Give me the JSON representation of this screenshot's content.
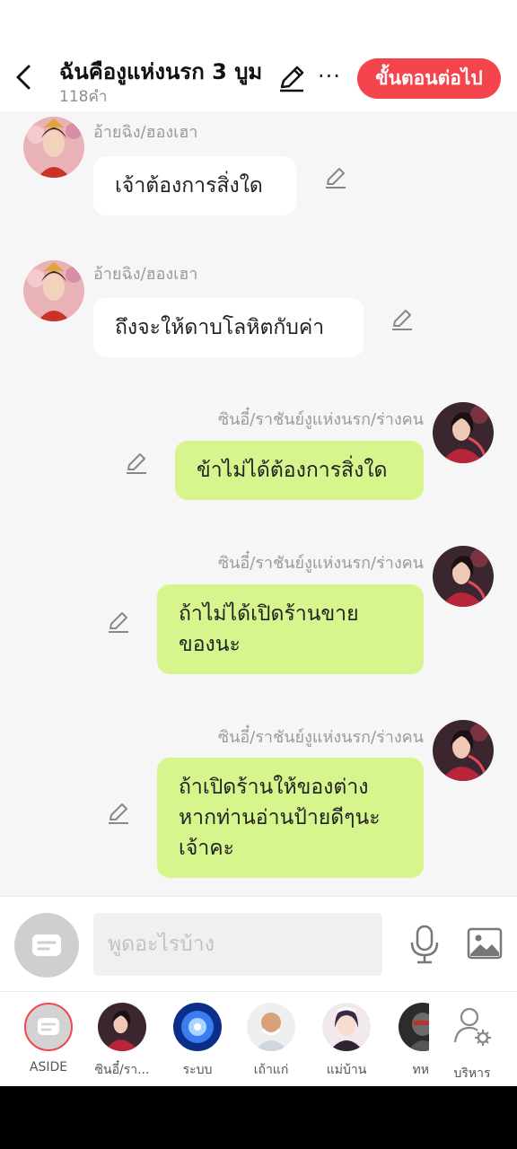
{
  "header": {
    "title": "ฉันคืองูแห่งนรก 3 บูม",
    "word_count": "118คำ",
    "next_label": "ขั้นตอนต่อไป",
    "more_label": "···",
    "accent_color": "#f4444c"
  },
  "messages": [
    {
      "side": "left",
      "speaker": "อ้ายฉิง/ฮองเฮา",
      "text": "เจ้าต้องการสิ่งใด",
      "avatar": "empress-avatar"
    },
    {
      "side": "left",
      "speaker": "อ้ายฉิง/ฮองเฮา",
      "text": "ถึงจะให้ดาบโลหิตกับค่า",
      "avatar": "empress-avatar"
    },
    {
      "side": "right",
      "speaker": "ซินอี๋/ราชันย์งูแห่งนรก/ร่างคน",
      "text": "ข้าไม่ได้ต้องการสิ่งใด",
      "avatar": "snake-queen-avatar"
    },
    {
      "side": "right",
      "speaker": "ซินอี๋/ราชันย์งูแห่งนรก/ร่างคน",
      "text_lines": [
        "ถ้าไม่ได้เปิดร้านขาย",
        "ของนะ"
      ],
      "avatar": "snake-queen-avatar"
    },
    {
      "side": "right",
      "speaker": "ซินอี๋/ราชันย์งูแห่งนรก/ร่างคน",
      "text_lines": [
        "ถ้าเปิดร้านให้ของต่าง",
        "หากท่านอ่านป้ายดีๆนะ",
        "เจ้าคะ"
      ],
      "avatar": "snake-queen-avatar"
    }
  ],
  "input": {
    "placeholder": "พูดอะไรบ้าง"
  },
  "characters": [
    {
      "label": "ASIDE",
      "icon": "aside-icon"
    },
    {
      "label": "ซินอี๋/รา...",
      "icon": "snake-queen-avatar"
    },
    {
      "label": "ระบบ",
      "icon": "system-orb-avatar"
    },
    {
      "label": "เถ้าแก่",
      "icon": "old-man-avatar"
    },
    {
      "label": "แม่บ้าน",
      "icon": "maid-avatar"
    },
    {
      "label": "ทห",
      "icon": "soldier-avatar"
    },
    {
      "label": "บริหาร",
      "icon": "manage-user-icon"
    }
  ]
}
